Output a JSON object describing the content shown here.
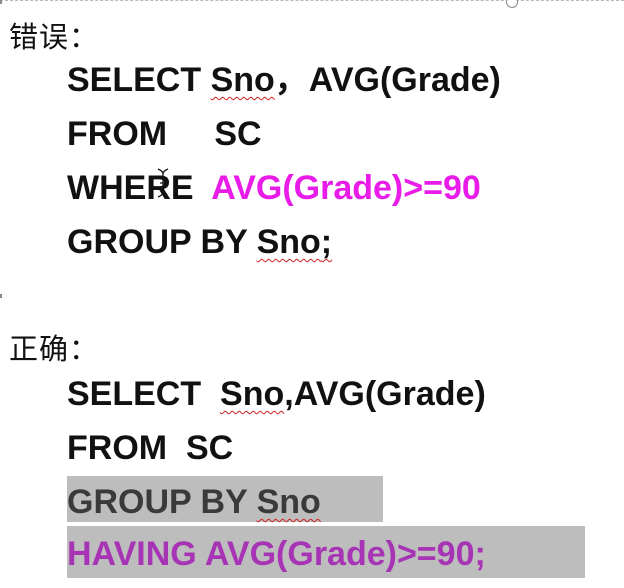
{
  "wrong": {
    "heading": "错误：",
    "line1": {
      "kw": "SELECT ",
      "col": "Sno",
      "rest": "，AVG(Grade)"
    },
    "line2": {
      "kw": "FROM     ",
      "table": "SC"
    },
    "line3": {
      "kw": "WHERE  ",
      "cond": "AVG(Grade)>=90"
    },
    "line4": {
      "kw": "GROUP BY ",
      "col": "Sno",
      "end": ";"
    }
  },
  "right": {
    "heading": "正确：",
    "line1": {
      "kw": "SELECT  ",
      "col": "Sno",
      "rest": ",AVG(Grade)"
    },
    "line2": {
      "kw": "FROM  ",
      "table": "SC"
    },
    "line3": {
      "kw": "GROUP BY ",
      "col": "Sno"
    },
    "line4": {
      "text": "HAVING AVG(Grade)>=90;"
    }
  },
  "colors": {
    "text": "#111111",
    "error_highlight": "#e81be8",
    "having_purple": "#a634b4",
    "selection_gray": "#bdbdbd",
    "spellcheck_red": "#d02020"
  },
  "icons": {
    "cursor": "text-cursor-ibeam-icon",
    "handle": "resize-handle-icon"
  }
}
